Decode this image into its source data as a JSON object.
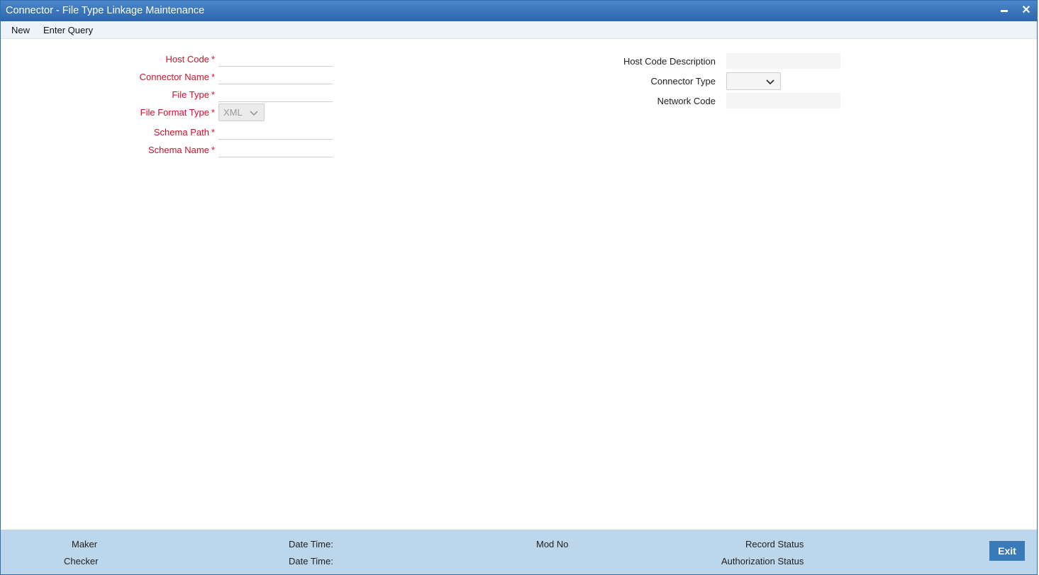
{
  "window": {
    "title": "Connector - File Type Linkage Maintenance",
    "minimize_icon": "minimize-icon",
    "close_icon": "close-icon",
    "close_glyph": "✕"
  },
  "menu": {
    "new_label": "New",
    "enter_query_label": "Enter Query"
  },
  "form_left": {
    "host_code_label": "Host Code",
    "connector_name_label": "Connector Name",
    "file_type_label": "File Type",
    "file_format_type_label": "File Format Type",
    "file_format_type_value": "XML",
    "schema_path_label": "Schema Path",
    "schema_name_label": "Schema Name",
    "required_marker": "*"
  },
  "form_right": {
    "host_code_description_label": "Host Code Description",
    "connector_type_label": "Connector Type",
    "connector_type_value": "",
    "network_code_label": "Network Code"
  },
  "footer": {
    "maker_label": "Maker",
    "checker_label": "Checker",
    "date_time_label_1": "Date Time:",
    "date_time_label_2": "Date Time:",
    "mod_no_label": "Mod No",
    "record_status_label": "Record Status",
    "authorization_status_label": "Authorization Status",
    "exit_label": "Exit"
  },
  "colors": {
    "titlebar": "#2c66ad",
    "required_label": "#d0112b",
    "footer_bg": "#bcd6eb",
    "exit_button": "#3a7ab8"
  }
}
